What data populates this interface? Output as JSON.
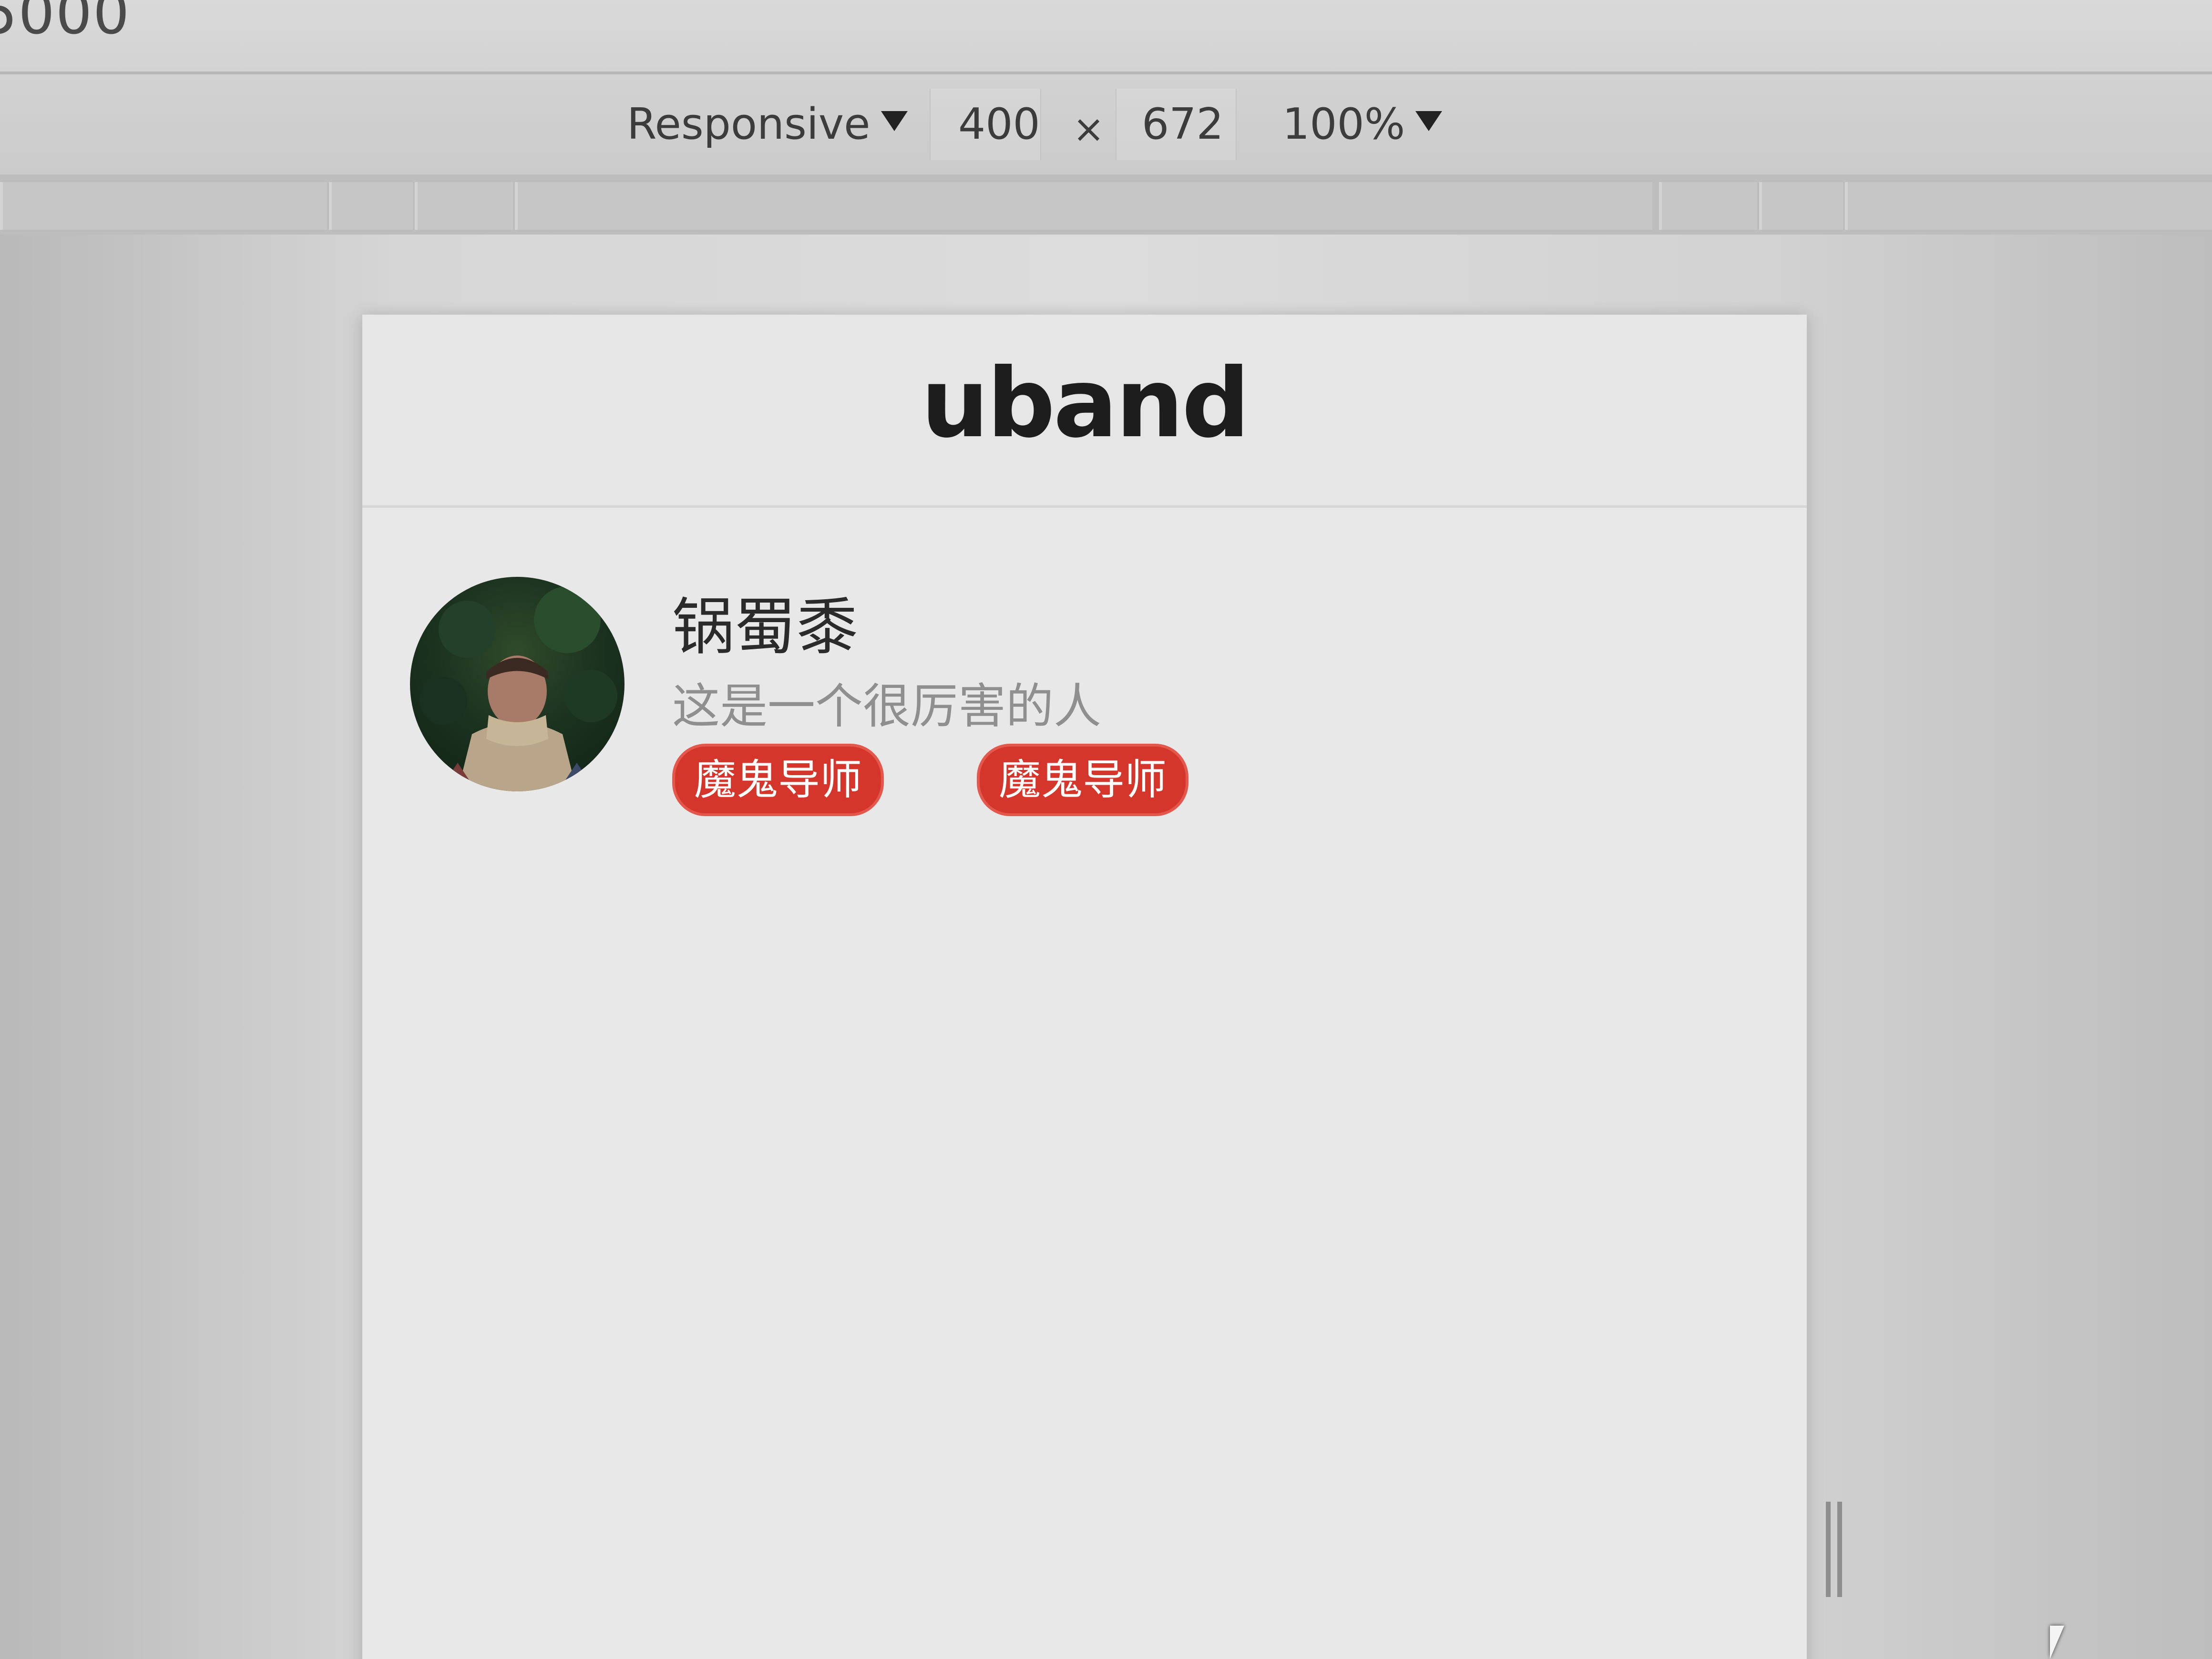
{
  "top_partial_text": "5000",
  "toolbar": {
    "device_mode": "Responsive",
    "width": "400",
    "times": "×",
    "height": "672",
    "zoom": "100%"
  },
  "app": {
    "logo": "uband",
    "profile": {
      "name": "锅蜀黍",
      "bio": "这是一个很厉害的人",
      "badges": [
        "魔鬼导师",
        "魔鬼导师"
      ]
    }
  },
  "colors": {
    "badge_bg": "#d5362b",
    "badge_text": "#ffffff",
    "logo": "#1d1d1d"
  }
}
